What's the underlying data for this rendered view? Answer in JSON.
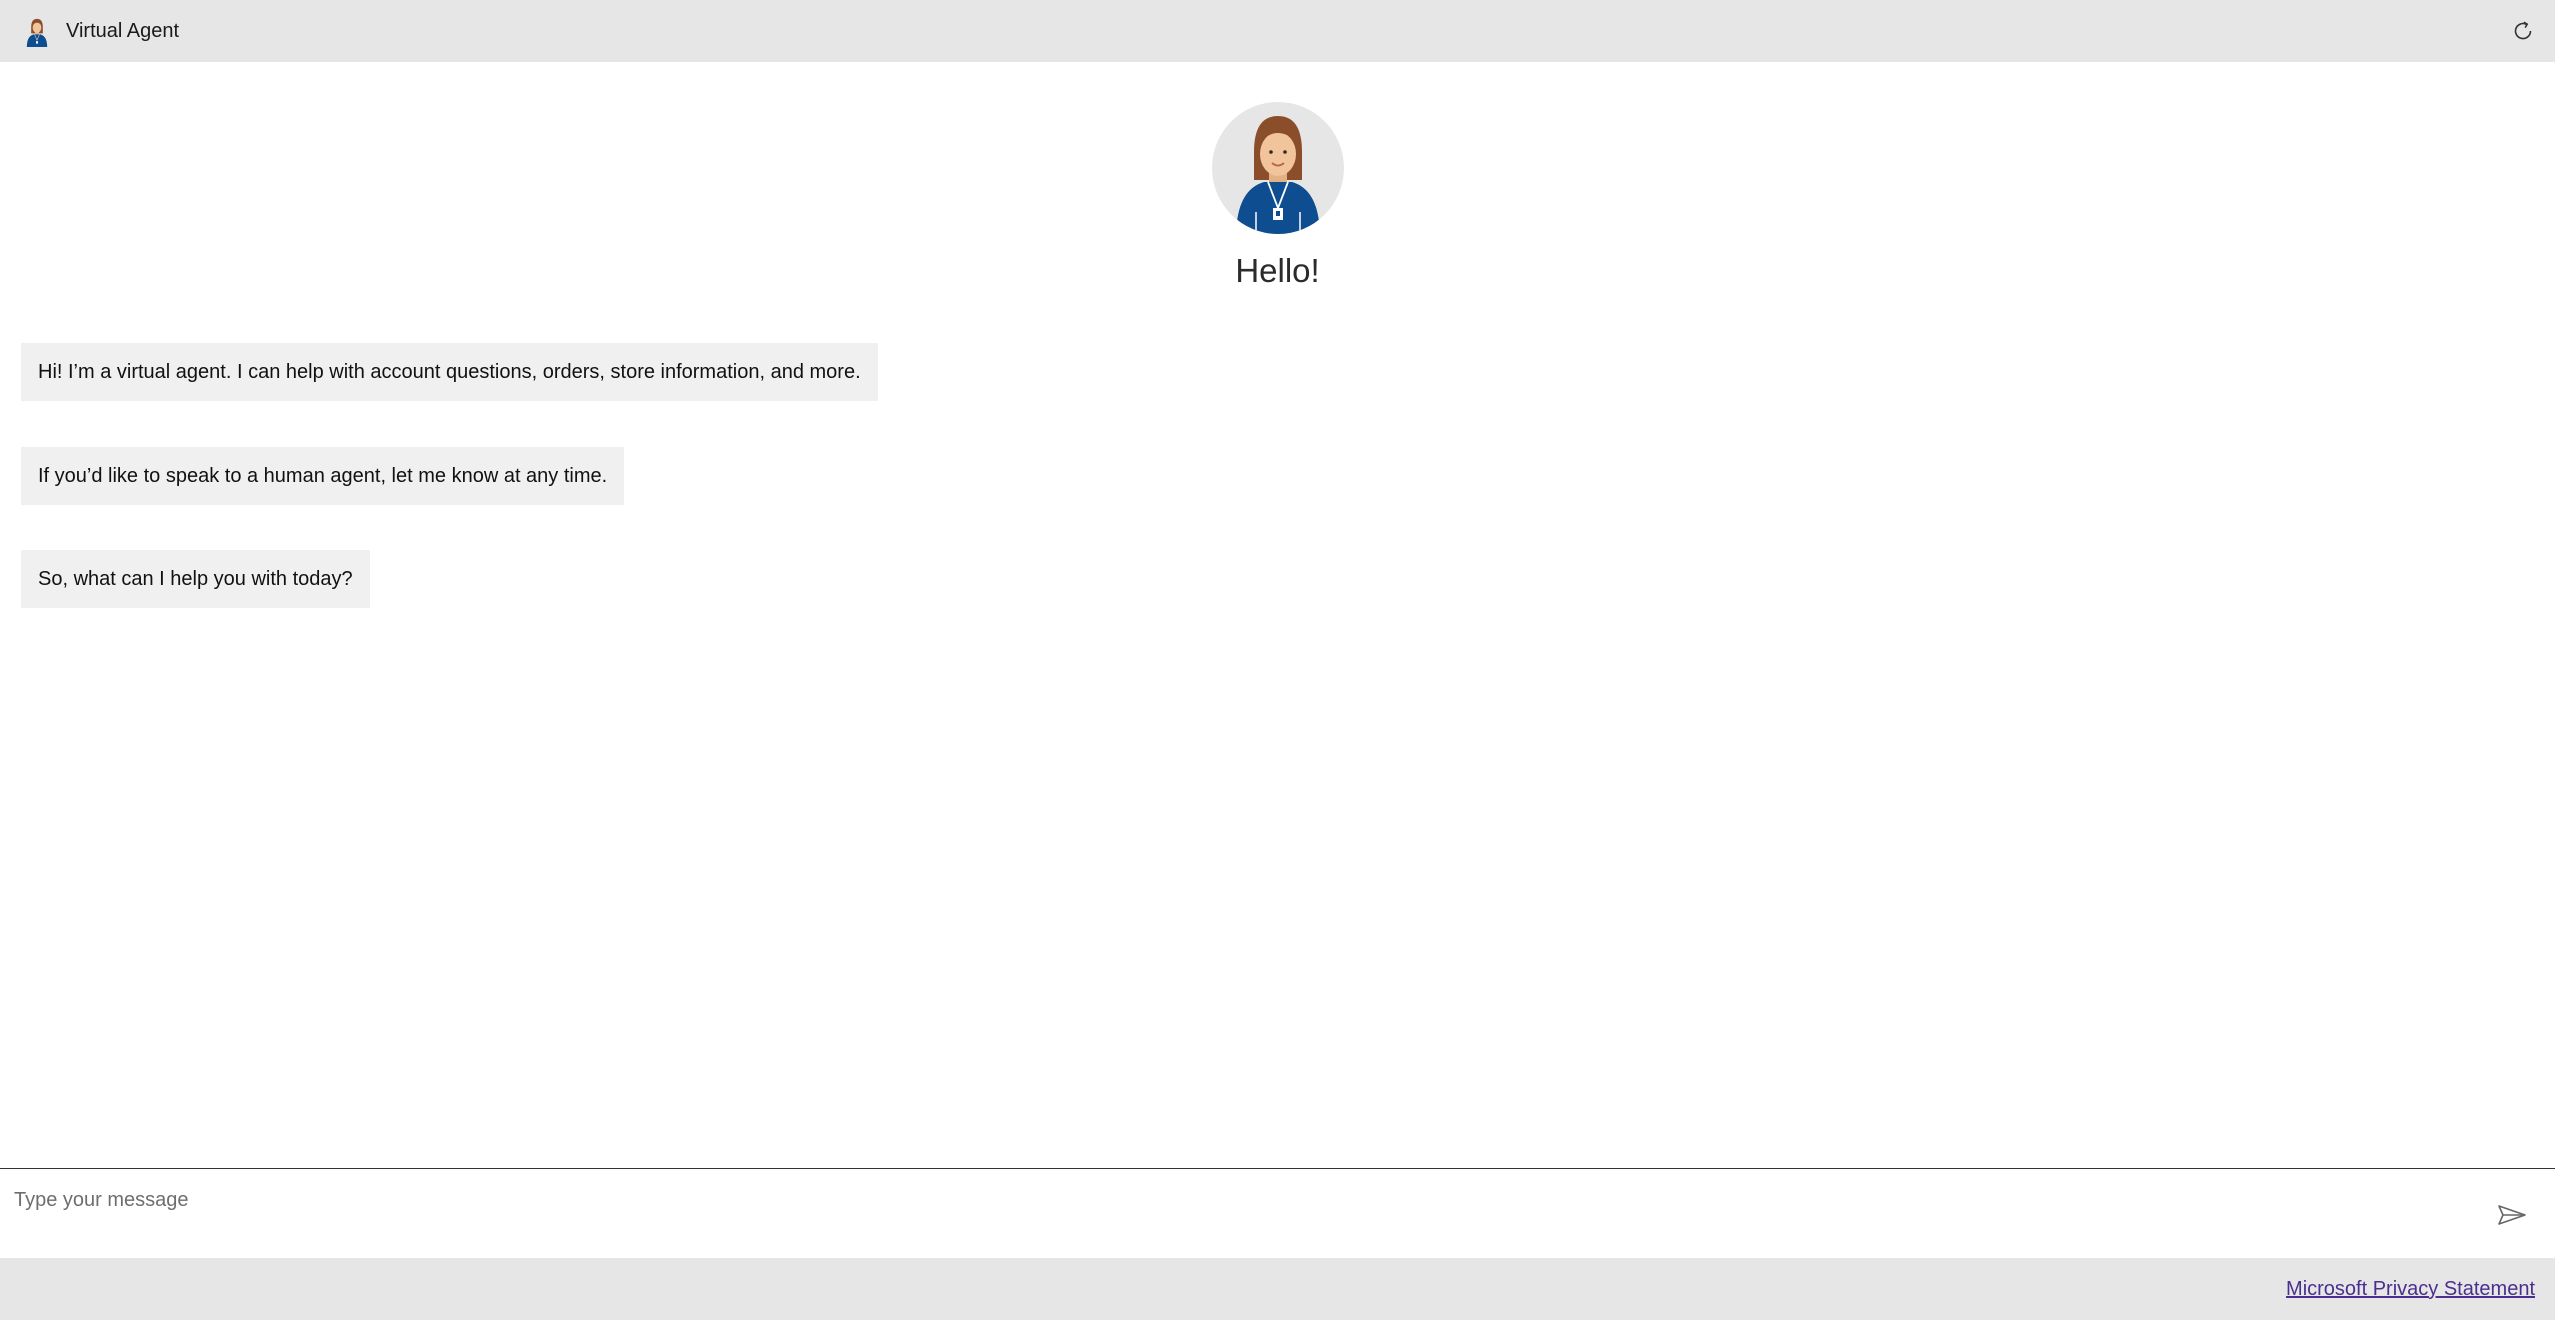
{
  "header": {
    "title": "Virtual Agent",
    "avatar_icon": "agent-avatar-icon",
    "refresh_icon": "refresh-icon"
  },
  "transcript": {
    "greeting": "Hello!",
    "messages": [
      "Hi! I’m a virtual agent. I can help with account questions, orders, store information, and more.",
      "If you’d like to speak to a human agent, let me know at any time.",
      "So, what can I help you with today?"
    ]
  },
  "composer": {
    "placeholder": "Type your message",
    "value": "",
    "send_icon": "send-icon"
  },
  "footer": {
    "privacy_link": "Microsoft Privacy Statement"
  },
  "colors": {
    "header_bg": "#e6e6e6",
    "bubble_bg": "#f0f0f0",
    "link": "#4b2f8f",
    "agent_shirt": "#0e4d8f",
    "agent_hair": "#8a4e2a"
  }
}
